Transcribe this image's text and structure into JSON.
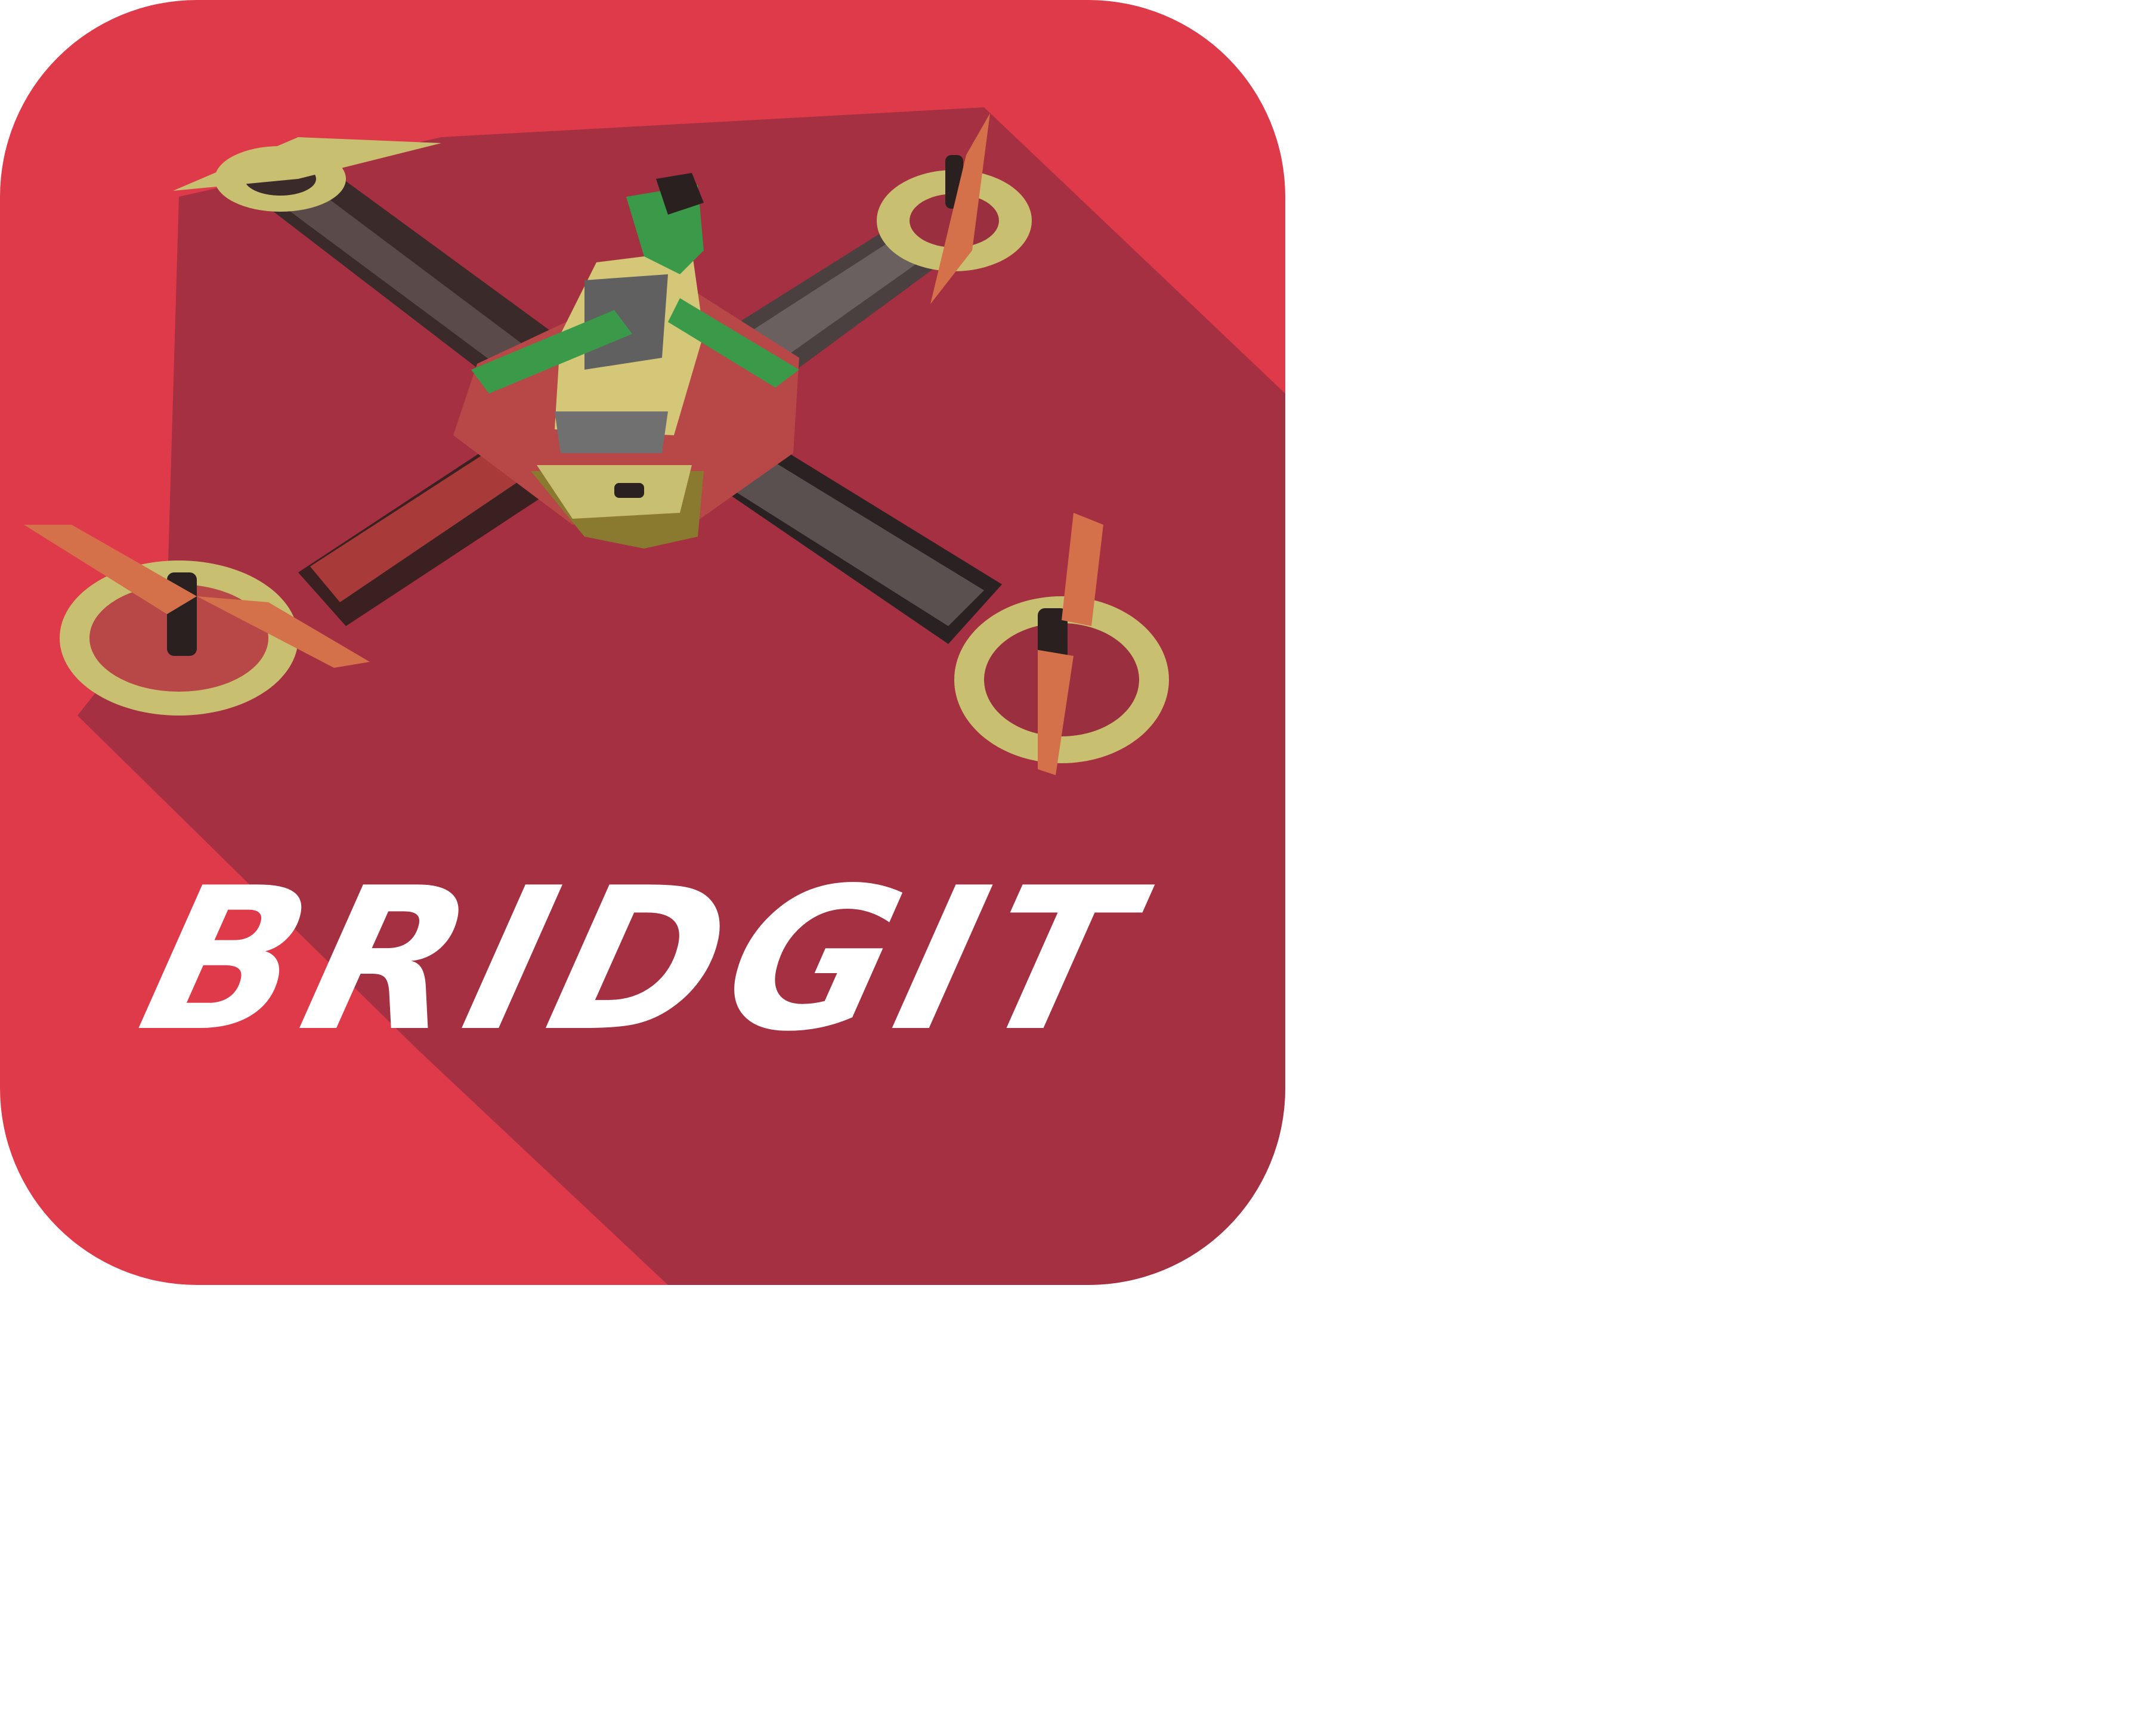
{
  "logo": {
    "wordmark": "BRIDGIT",
    "colors": {
      "background": "#de3a4a",
      "long_shadow": "#9a2f3f",
      "wordmark": "#ffffff",
      "frame_arm": "#3a2a2a",
      "frame_arm_light": "#5a5050",
      "motor_mount": "#c8c070",
      "propeller": "#d4714a",
      "board": "#b84848",
      "electronics_green": "#3a9a4a",
      "electronics_grey": "#707070"
    },
    "icons": [
      "quadcopter-drone-icon"
    ]
  }
}
